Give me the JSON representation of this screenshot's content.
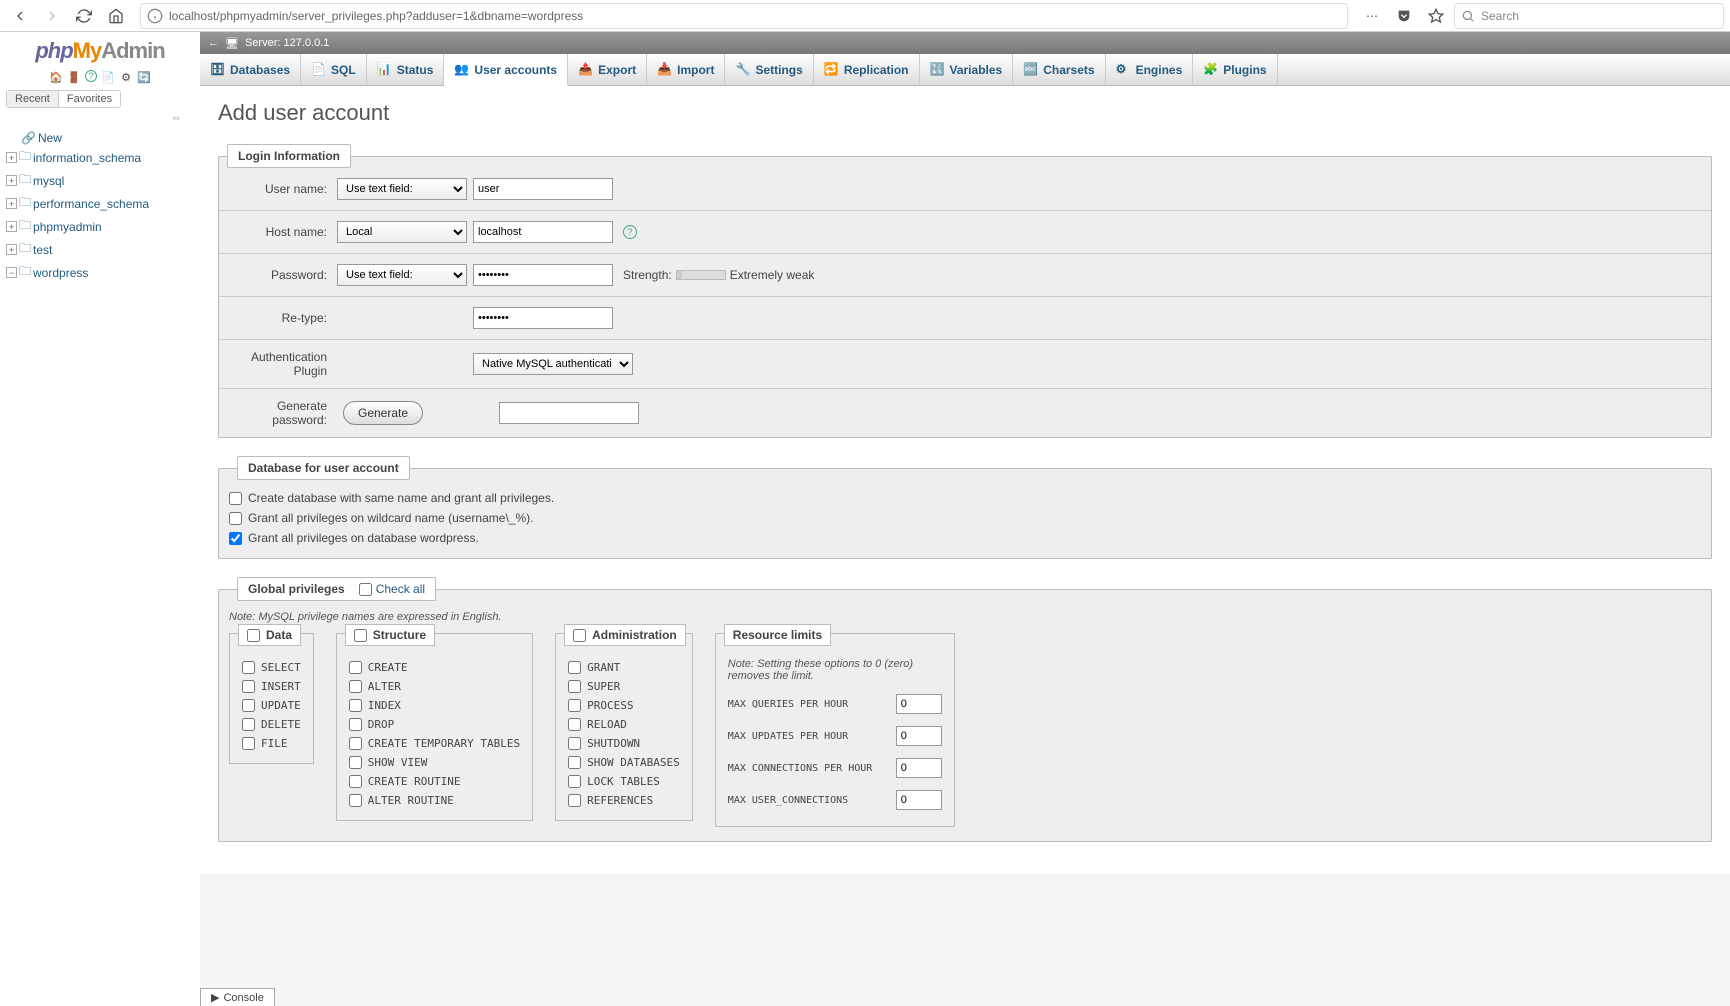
{
  "browser": {
    "url": "localhost/phpmyadmin/server_privileges.php?adduser=1&dbname=wordpress",
    "search_placeholder": "Search"
  },
  "logo": {
    "php": "php",
    "my": "My",
    "admin": "Admin"
  },
  "sidebar": {
    "tabs": {
      "recent": "Recent",
      "favorites": "Favorites"
    },
    "new": "New",
    "dbs": [
      "information_schema",
      "mysql",
      "performance_schema",
      "phpmyadmin",
      "test",
      "wordpress"
    ]
  },
  "server_bar": {
    "label": "Server: 127.0.0.1"
  },
  "top_tabs": [
    "Databases",
    "SQL",
    "Status",
    "User accounts",
    "Export",
    "Import",
    "Settings",
    "Replication",
    "Variables",
    "Charsets",
    "Engines",
    "Plugins"
  ],
  "active_tab": "User accounts",
  "page_title": "Add user account",
  "fieldsets": {
    "login": {
      "legend": "Login Information",
      "username": {
        "label": "User name:",
        "mode": "Use text field:",
        "value": "user"
      },
      "hostname": {
        "label": "Host name:",
        "mode": "Local",
        "value": "localhost"
      },
      "password": {
        "label": "Password:",
        "mode": "Use text field:",
        "value": "password",
        "strength_label": "Strength:",
        "strength_value": "Extremely weak"
      },
      "retype": {
        "label": "Re-type:",
        "value": "password"
      },
      "auth": {
        "label": "Authentication Plugin",
        "value": "Native MySQL authentication"
      },
      "generate": {
        "label": "Generate password:",
        "button": "Generate"
      }
    },
    "db": {
      "legend": "Database for user account",
      "items": [
        {
          "label": "Create database with same name and grant all privileges.",
          "checked": false
        },
        {
          "label": "Grant all privileges on wildcard name (username\\_%).",
          "checked": false
        },
        {
          "label": "Grant all privileges on database wordpress.",
          "checked": true
        }
      ]
    },
    "global": {
      "legend": "Global privileges",
      "check_all": "Check all",
      "note": "Note: MySQL privilege names are expressed in English.",
      "data": {
        "legend": "Data",
        "items": [
          "SELECT",
          "INSERT",
          "UPDATE",
          "DELETE",
          "FILE"
        ]
      },
      "structure": {
        "legend": "Structure",
        "items": [
          "CREATE",
          "ALTER",
          "INDEX",
          "DROP",
          "CREATE TEMPORARY TABLES",
          "SHOW VIEW",
          "CREATE ROUTINE",
          "ALTER ROUTINE"
        ]
      },
      "admin": {
        "legend": "Administration",
        "items": [
          "GRANT",
          "SUPER",
          "PROCESS",
          "RELOAD",
          "SHUTDOWN",
          "SHOW DATABASES",
          "LOCK TABLES",
          "REFERENCES"
        ]
      },
      "resource": {
        "legend": "Resource limits",
        "note": "Note: Setting these options to 0 (zero) removes the limit.",
        "items": [
          {
            "label": "MAX QUERIES PER HOUR",
            "value": "0"
          },
          {
            "label": "MAX UPDATES PER HOUR",
            "value": "0"
          },
          {
            "label": "MAX CONNECTIONS PER HOUR",
            "value": "0"
          },
          {
            "label": "MAX USER_CONNECTIONS",
            "value": "0"
          }
        ]
      }
    }
  },
  "console": "Console"
}
